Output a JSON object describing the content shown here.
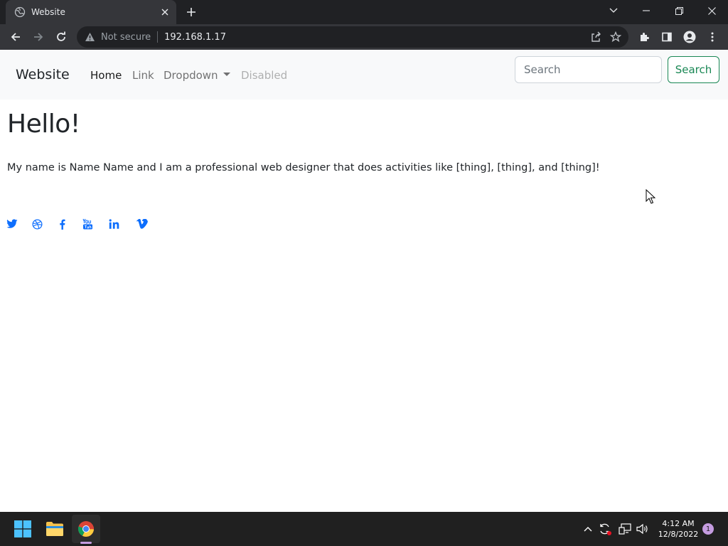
{
  "browser": {
    "tab": {
      "title": "Website",
      "favicon": "globe-icon"
    },
    "address": {
      "security_label": "Not secure",
      "url": "192.168.1.17"
    }
  },
  "site": {
    "brand": "Website",
    "nav": {
      "home": "Home",
      "link": "Link",
      "dropdown": "Dropdown",
      "disabled": "Disabled"
    },
    "search": {
      "placeholder": "Search",
      "button": "Search"
    },
    "heading": "Hello!",
    "intro": "My name is Name Name and I am a professional web designer that does activities like [thing], [thing], and [thing]!",
    "social_icons": [
      "twitter-icon",
      "dribbble-icon",
      "facebook-icon",
      "youtube-icon",
      "linkedin-icon",
      "vimeo-icon"
    ]
  },
  "taskbar": {
    "time": "4:12 AM",
    "date": "12/8/2022",
    "notifications": "1"
  },
  "colors": {
    "brand_green": "#198754",
    "social_blue": "#0d6efd",
    "navbar_bg": "#f8f9fa",
    "chrome_dark": "#202124"
  }
}
